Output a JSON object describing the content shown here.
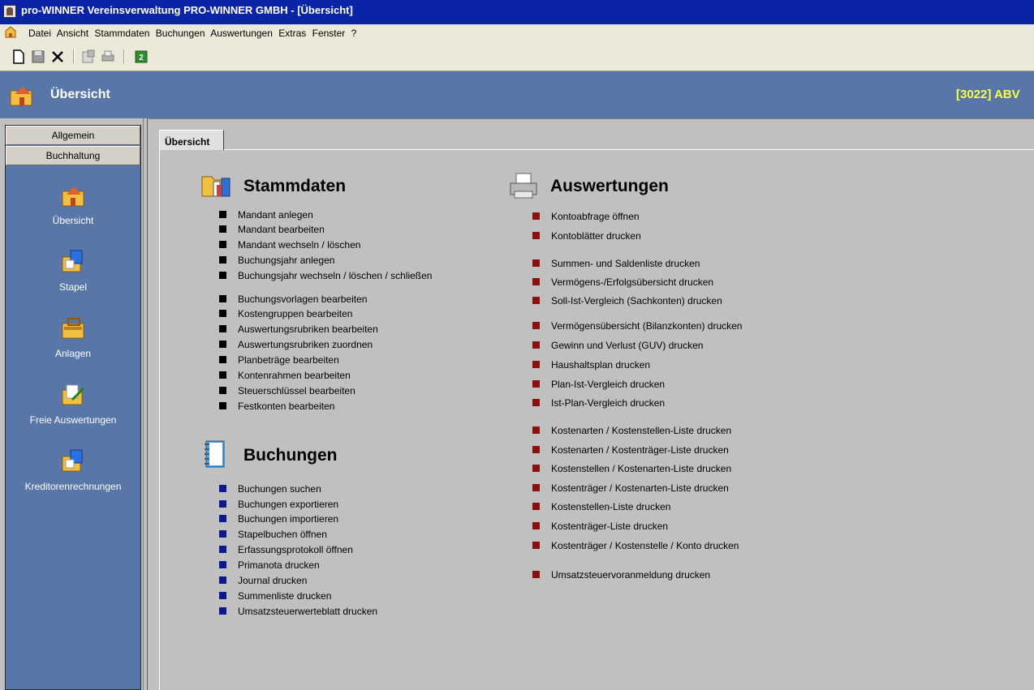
{
  "window": {
    "title": "pro-WINNER Vereinsverwaltung  PRO-WINNER GMBH - [Übersicht]"
  },
  "menu": [
    "Datei",
    "Ansicht",
    "Stammdaten",
    "Buchungen",
    "Auswertungen",
    "Extras",
    "Fenster",
    "?"
  ],
  "toolbar": {
    "icons": [
      "new-document-icon",
      "save-icon",
      "delete-icon",
      "properties-icon",
      "print-icon",
      "refresh-icon"
    ]
  },
  "header": {
    "title": "Übersicht",
    "code": "[3022] ABV"
  },
  "sidebar": {
    "buttons": [
      "Allgemein",
      "Buchhaltung"
    ],
    "items": [
      "Übersicht",
      "Stapel",
      "Anlagen",
      "Freie Auswertungen",
      "Kreditorenrechnungen"
    ]
  },
  "tab": {
    "label": "Übersicht"
  },
  "stammdaten": {
    "title": "Stammdaten",
    "items": [
      "Mandant anlegen",
      "Mandant bearbeiten",
      "Mandant wechseln / löschen",
      "Buchungsjahr anlegen",
      "Buchungsjahr wechseln / löschen / schließen",
      "Buchungsvorlagen bearbeiten",
      "Kostengruppen bearbeiten",
      "Auswertungsrubriken bearbeiten",
      "Auswertungsrubriken zuordnen",
      "Planbeträge bearbeiten",
      "Kontenrahmen bearbeiten",
      "Steuerschlüssel bearbeiten",
      "Festkonten bearbeiten"
    ]
  },
  "buchungen": {
    "title": "Buchungen",
    "items": [
      "Buchungen suchen",
      "Buchungen exportieren",
      "Buchungen importieren",
      "Stapelbuchen öffnen",
      "Erfassungsprotokoll öffnen",
      "Primanota drucken",
      "Journal drucken",
      "Summenliste drucken",
      "Umsatzsteuerwerteblatt drucken"
    ]
  },
  "auswertungen": {
    "title": "Auswertungen",
    "items": [
      "Kontoabfrage öffnen",
      "Kontoblätter drucken",
      "Summen- und Saldenliste drucken",
      "Vermögens-/Erfolgsübersicht drucken",
      "Soll-Ist-Vergleich (Sachkonten) drucken",
      "Vermögensübersicht (Bilanzkonten) drucken",
      "Gewinn und Verlust (GUV) drucken",
      "Haushaltsplan drucken",
      "Plan-Ist-Vergleich drucken",
      "Ist-Plan-Vergleich drucken",
      "Kostenarten / Kostenstellen-Liste drucken",
      "Kostenarten / Kostenträger-Liste drucken",
      "Kostenstellen / Kostenarten-Liste drucken",
      "Kostenträger / Kostenarten-Liste drucken",
      "Kostenstellen-Liste drucken",
      "Kostenträger-Liste drucken",
      "Kostenträger / Kostenstelle / Konto drucken",
      "Umsatzsteuervoranmeldung drucken"
    ]
  },
  "colors": {
    "titlebar": "#0a24a8",
    "header": "#5877a8",
    "header_code": "#ffff40",
    "bullet_stammdaten": "#000000",
    "bullet_buchungen": "#0a1a8c",
    "bullet_auswertungen": "#8b1010"
  }
}
